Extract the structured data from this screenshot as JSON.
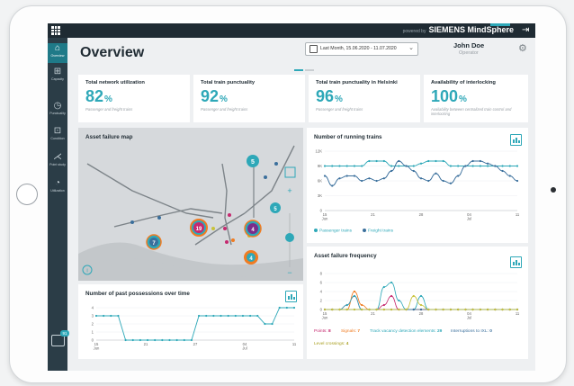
{
  "header": {
    "brand_prefix": "powered by",
    "brand_company": "SIEMENS",
    "brand_product": "MindSphere"
  },
  "sidebar": {
    "items": [
      {
        "label": "Overview",
        "icon": "home-icon"
      },
      {
        "label": "Capacity",
        "icon": "capacity-icon"
      },
      {
        "label": "Punctuality",
        "icon": "punctuality-icon"
      },
      {
        "label": "Condition",
        "icon": "condition-icon"
      },
      {
        "label": "Point study",
        "icon": "point-study-icon"
      },
      {
        "label": "Utilization",
        "icon": "utilization-icon"
      }
    ],
    "chat_badge": "91"
  },
  "page": {
    "title": "Overview",
    "date_range": "Last Month, 15.06.2020 - 11.07.2020",
    "user_name": "John Doe",
    "user_role": "Operator"
  },
  "kpis": [
    {
      "label": "Total network utilization",
      "value": "82",
      "unit": "%",
      "sub": "Passenger and freight trains"
    },
    {
      "label": "Total train punctuality",
      "value": "92",
      "unit": "%",
      "sub": "Passenger and freight trains"
    },
    {
      "label": "Total train punctuality in Helsinki",
      "value": "96",
      "unit": "%",
      "sub": "Passenger and freight trains"
    },
    {
      "label": "Availability of interlocking",
      "value": "100",
      "unit": "%",
      "sub": "Availability between centralized train control and interlocking"
    }
  ],
  "map": {
    "title": "Asset failure map",
    "markers": [
      "5",
      "19",
      "4",
      "7",
      "4",
      "5"
    ],
    "info_glyph": "i",
    "zoom_in": "+",
    "zoom_out": "−"
  },
  "running": {
    "title": "Number of running trains",
    "chart_data": {
      "type": "line",
      "title": "Number of running trains",
      "y_ticks": [
        "12K",
        "9K",
        "6K",
        "3K",
        "0"
      ],
      "x_ticks": [
        "15",
        "21",
        "28",
        "04",
        "11"
      ],
      "x_sub": [
        "Jun",
        "",
        "",
        "Jul",
        ""
      ],
      "ylim": [
        0,
        12000
      ],
      "series": [
        {
          "name": "Passenger trains",
          "color": "#2ea8b8",
          "values": [
            9000,
            9000,
            9000,
            9000,
            9000,
            9000,
            10000,
            10000,
            10000,
            9000,
            9000,
            9000,
            9000,
            9500,
            10000,
            10000,
            10000,
            9000,
            9000,
            9000,
            9000,
            9000,
            9000,
            9000,
            9000,
            9000,
            9000
          ]
        },
        {
          "name": "Freight trains",
          "color": "#3a6f9c",
          "values": [
            7000,
            5000,
            6500,
            7000,
            7000,
            6000,
            6500,
            6000,
            6500,
            8000,
            10000,
            9000,
            8000,
            6500,
            6000,
            7500,
            6000,
            5500,
            7000,
            9000,
            10000,
            10000,
            9500,
            9000,
            8000,
            7000,
            6000
          ]
        }
      ]
    }
  },
  "possessions": {
    "title": "Number of past possessions over time",
    "chart_data": {
      "type": "line",
      "title": "Number of past possessions over time",
      "y_ticks": [
        "4",
        "3",
        "2",
        "1",
        "0"
      ],
      "x_ticks": [
        "15",
        "21",
        "27",
        "04",
        "11"
      ],
      "x_sub": [
        "Jun",
        "",
        "",
        "Jul",
        ""
      ],
      "ylim": [
        0,
        4
      ],
      "series": [
        {
          "name": "",
          "color": "#2ea8b8",
          "values": [
            3,
            3,
            3,
            3,
            0,
            0,
            0,
            0,
            0,
            0,
            0,
            0,
            0,
            0,
            3,
            3,
            3,
            3,
            3,
            3,
            3,
            3,
            3,
            2,
            2,
            4,
            4,
            4
          ]
        }
      ]
    }
  },
  "failures": {
    "title": "Asset failure frequency",
    "chart_data": {
      "type": "line",
      "title": "Asset failure frequency",
      "y_ticks": [
        "8",
        "6",
        "4",
        "2",
        "0"
      ],
      "x_ticks": [
        "15",
        "21",
        "28",
        "04",
        "11"
      ],
      "x_sub": [
        "Jun",
        "",
        "",
        "Jul",
        ""
      ],
      "ylim": [
        0,
        8
      ],
      "series": [
        {
          "name": "Points",
          "value": "8",
          "color": "#c5296f",
          "values": [
            0,
            0,
            0,
            1,
            3,
            0,
            0,
            0,
            1,
            3,
            0,
            0,
            0,
            0,
            0,
            0,
            0,
            0,
            0,
            0,
            0,
            0,
            0,
            0,
            0,
            0,
            0
          ]
        },
        {
          "name": "Signals",
          "value": "7",
          "color": "#f07c22",
          "values": [
            0,
            0,
            0,
            0,
            4,
            1,
            0,
            0,
            0,
            0,
            0,
            0,
            0,
            0,
            0,
            0,
            0,
            0,
            0,
            0,
            0,
            0,
            0,
            0,
            0,
            0,
            0
          ]
        },
        {
          "name": "Track vacancy detection elements",
          "value": "29",
          "color": "#2ea8b8",
          "values": [
            0,
            0,
            0,
            1,
            3,
            0,
            0,
            0,
            5,
            6,
            2,
            0,
            0,
            3,
            0,
            0,
            0,
            0,
            0,
            0,
            0,
            0,
            0,
            0,
            0,
            0,
            0
          ]
        },
        {
          "name": "Interruptions to IXL",
          "value": "0",
          "color": "#3a6f9c",
          "values": [
            0,
            0,
            0,
            0,
            0,
            0,
            0,
            0,
            0,
            0,
            0,
            0,
            0,
            0,
            0,
            0,
            0,
            0,
            0,
            0,
            0,
            0,
            0,
            0,
            0,
            0,
            0
          ]
        },
        {
          "name": "Level crossings",
          "value": "4",
          "color": "#c8c23a",
          "values": [
            0,
            0,
            0,
            0,
            0,
            0,
            0,
            0,
            0,
            0,
            0,
            0,
            3,
            1,
            0,
            0,
            0,
            0,
            0,
            0,
            0,
            0,
            0,
            0,
            0,
            0,
            0
          ]
        }
      ]
    }
  },
  "colors": {
    "accent": "#2ea8b8",
    "sidebar": "#2b3d47",
    "topbar": "#1f2b33"
  }
}
